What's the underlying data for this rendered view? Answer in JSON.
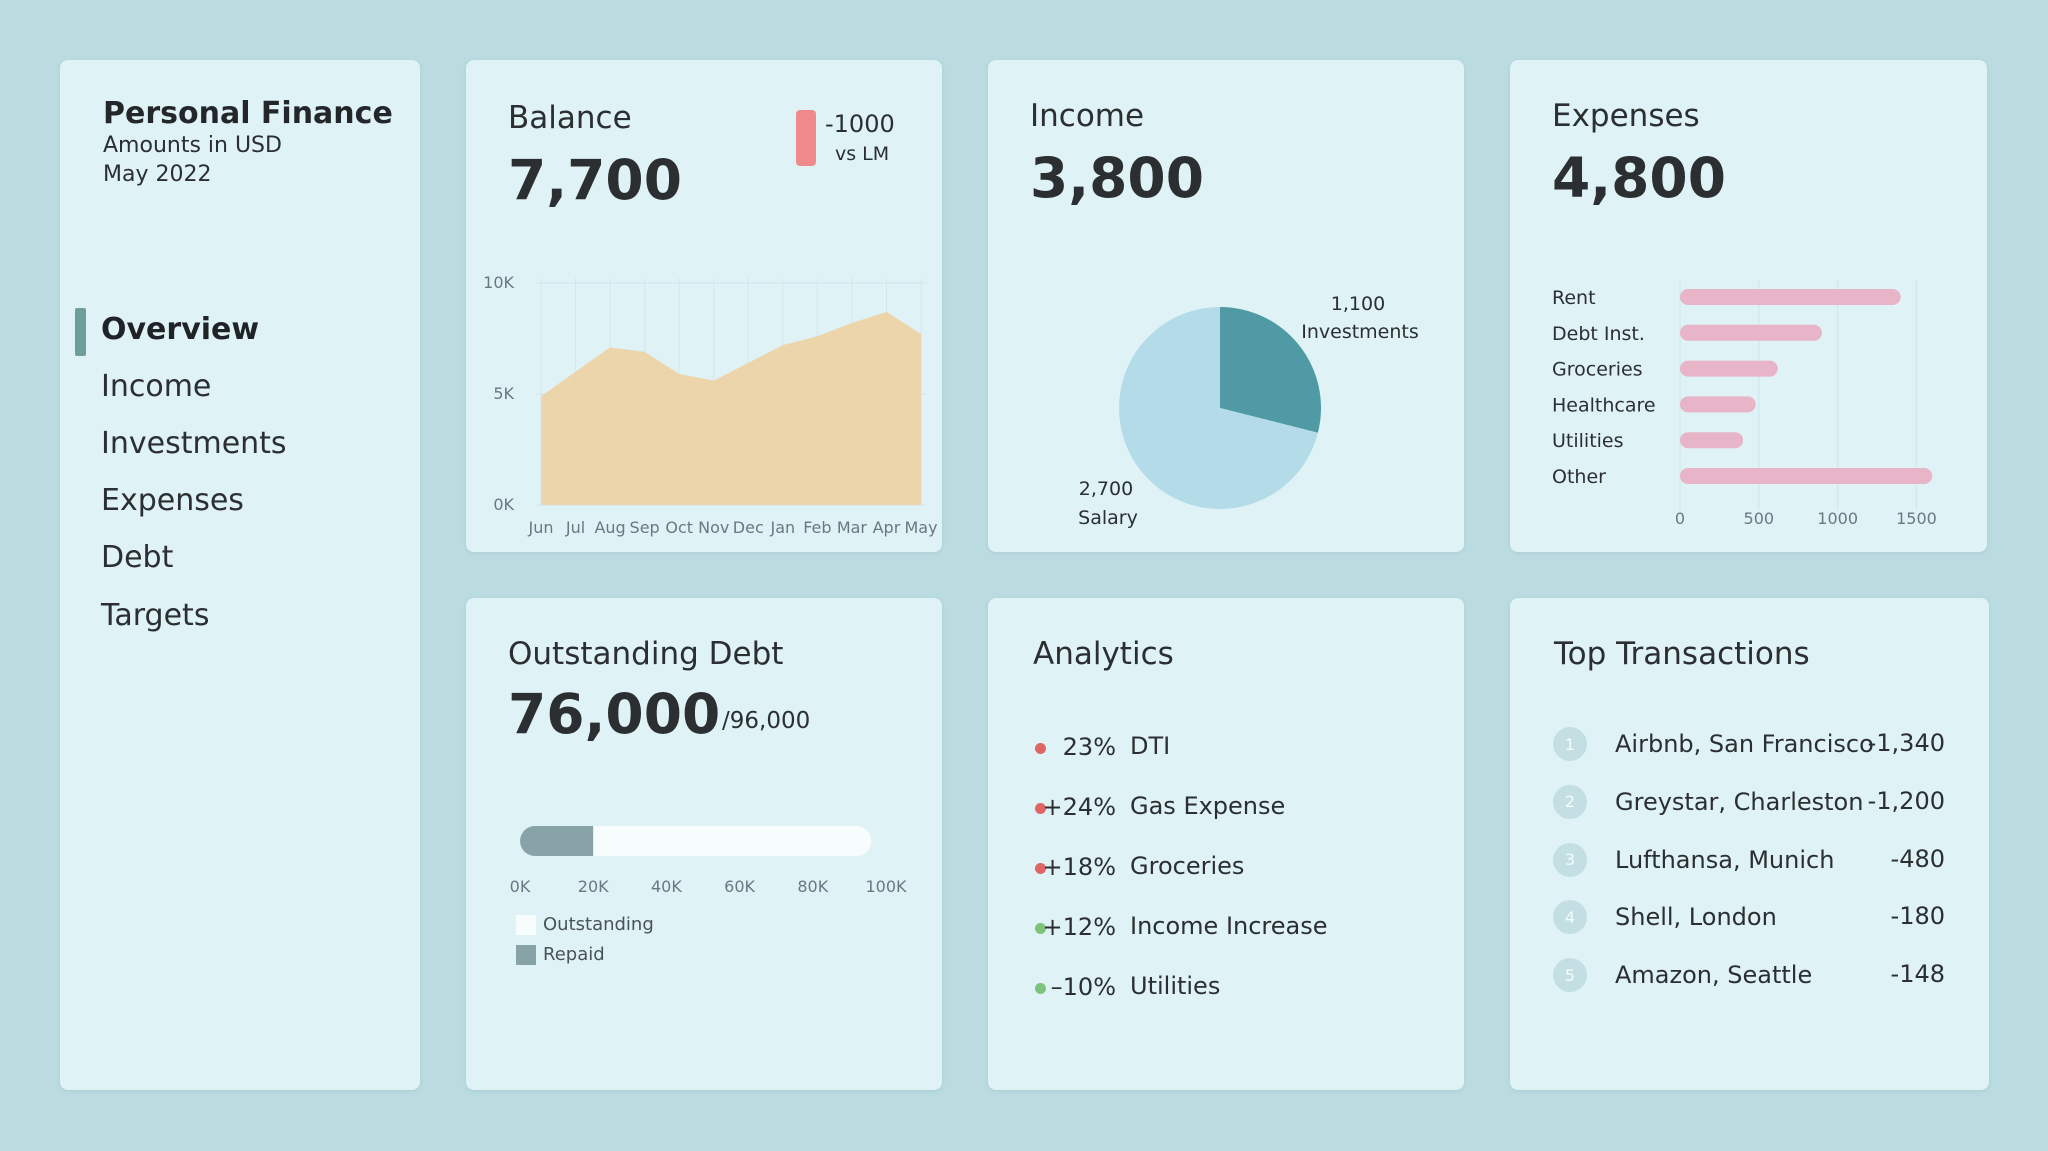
{
  "sidebar": {
    "title": "Personal Finance",
    "subtitle": "Amounts in USD",
    "period": "May 2022",
    "nav": [
      {
        "label": "Overview",
        "active": true
      },
      {
        "label": "Income",
        "active": false
      },
      {
        "label": "Investments",
        "active": false
      },
      {
        "label": "Expenses",
        "active": false
      },
      {
        "label": "Debt",
        "active": false
      },
      {
        "label": "Targets",
        "active": false
      }
    ]
  },
  "balance": {
    "title": "Balance",
    "value": "7,700",
    "change": "-1000",
    "change_label": "vs LM",
    "change_color": "#f08a8a"
  },
  "income": {
    "title": "Income",
    "value": "3,800"
  },
  "expenses": {
    "title": "Expenses",
    "value": "4,800"
  },
  "debt": {
    "title": "Outstanding Debt",
    "value": "76,000",
    "total": "/96,000",
    "legend_outstanding": "Outstanding",
    "legend_repaid": "Repaid"
  },
  "analytics": {
    "title": "Analytics",
    "items": [
      {
        "value": "23%",
        "label": "DTI",
        "color": "#e06666"
      },
      {
        "value": "+24%",
        "label": "Gas Expense",
        "color": "#e06666"
      },
      {
        "value": "+18%",
        "label": "Groceries",
        "color": "#e06666"
      },
      {
        "value": "+12%",
        "label": "Income Increase",
        "color": "#7cc47c"
      },
      {
        "value": "–10%",
        "label": "Utilities",
        "color": "#7cc47c"
      }
    ]
  },
  "transactions": {
    "title": "Top Transactions",
    "items": [
      {
        "rank": "1",
        "name": "Airbnb, San Francisco",
        "amount": "-1,340"
      },
      {
        "rank": "2",
        "name": "Greystar, Charleston",
        "amount": "-1,200"
      },
      {
        "rank": "3",
        "name": "Lufthansa, Munich",
        "amount": "-480"
      },
      {
        "rank": "4",
        "name": "Shell, London",
        "amount": "-180"
      },
      {
        "rank": "5",
        "name": "Amazon, Seattle",
        "amount": "-148"
      }
    ]
  },
  "chart_data": [
    {
      "type": "area",
      "x": [
        "Jun",
        "Jul",
        "Aug",
        "Sep",
        "Oct",
        "Nov",
        "Dec",
        "Jan",
        "Feb",
        "Mar",
        "Apr",
        "May"
      ],
      "values": [
        4900,
        6000,
        7100,
        6900,
        5900,
        5600,
        6400,
        7200,
        7600,
        8200,
        8700,
        7700
      ],
      "ylim": [
        0,
        10000
      ],
      "ytick_labels": [
        "0K",
        "5K",
        "10K"
      ],
      "color": "#edd3a7",
      "grid": true
    },
    {
      "type": "pie",
      "slices": [
        {
          "label": "Investments",
          "value": 1100,
          "value_label": "1,100",
          "color": "#4f9aa4"
        },
        {
          "label": "Salary",
          "value": 2700,
          "value_label": "2,700",
          "color": "#b4dbe8"
        }
      ]
    },
    {
      "type": "bar",
      "orientation": "horizontal",
      "categories": [
        "Rent",
        "Debt Inst.",
        "Groceries",
        "Healthcare",
        "Utilities",
        "Other"
      ],
      "values": [
        1400,
        900,
        620,
        480,
        400,
        1600
      ],
      "xlim": [
        0,
        1700
      ],
      "xtick_values": [
        0,
        500,
        1000,
        1500
      ],
      "xtick_labels": [
        "0",
        "500",
        "1000",
        "1500"
      ],
      "color": "#e8b4c8",
      "grid": true
    },
    {
      "type": "bar",
      "orientation": "horizontal",
      "stacked": true,
      "series": [
        {
          "name": "Repaid",
          "value": 20000,
          "color": "#87a3a8"
        },
        {
          "name": "Outstanding",
          "value": 76000,
          "color": "#f7fcfd"
        }
      ],
      "xlim": [
        0,
        100000
      ],
      "xtick_labels": [
        "0K",
        "20K",
        "40K",
        "60K",
        "80K",
        "100K"
      ]
    }
  ]
}
